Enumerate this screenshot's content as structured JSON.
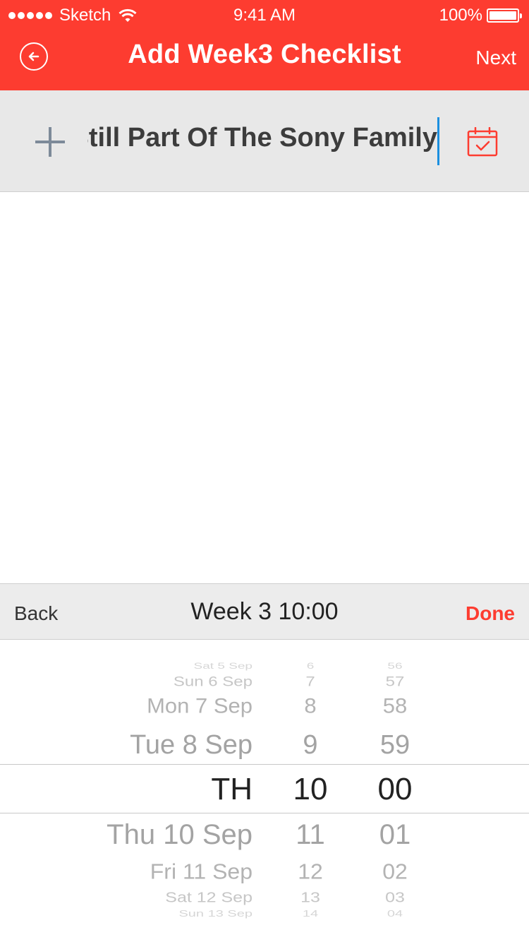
{
  "status_bar": {
    "carrier": "Sketch",
    "time": "9:41 AM",
    "battery": "100%"
  },
  "nav": {
    "title": "Add Week3 Checklist",
    "next_label": "Next"
  },
  "task_input": {
    "value": "Still Part Of The Sony Family"
  },
  "picker_toolbar": {
    "back_label": "Back",
    "title": "Week 3  10:00",
    "done_label": "Done"
  },
  "picker": {
    "dates": [
      "Sat 5 Sep",
      "Sun 6 Sep",
      "Mon 7 Sep",
      "Tue 8 Sep",
      "TH",
      "Thu 10 Sep",
      "Fri 11 Sep",
      "Sat 12 Sep",
      "Sun 13 Sep"
    ],
    "hours": [
      "6",
      "7",
      "8",
      "9",
      "10",
      "11",
      "12",
      "13",
      "14"
    ],
    "minutes": [
      "56",
      "57",
      "58",
      "59",
      "00",
      "01",
      "02",
      "03",
      "04"
    ],
    "selected_index": 4
  },
  "colors": {
    "accent": "#fd3c30",
    "caret": "#1b8fe0",
    "plus_icon": "#7d8a99",
    "toolbar_bg": "#ececec",
    "input_bg": "#e8e8e8"
  }
}
